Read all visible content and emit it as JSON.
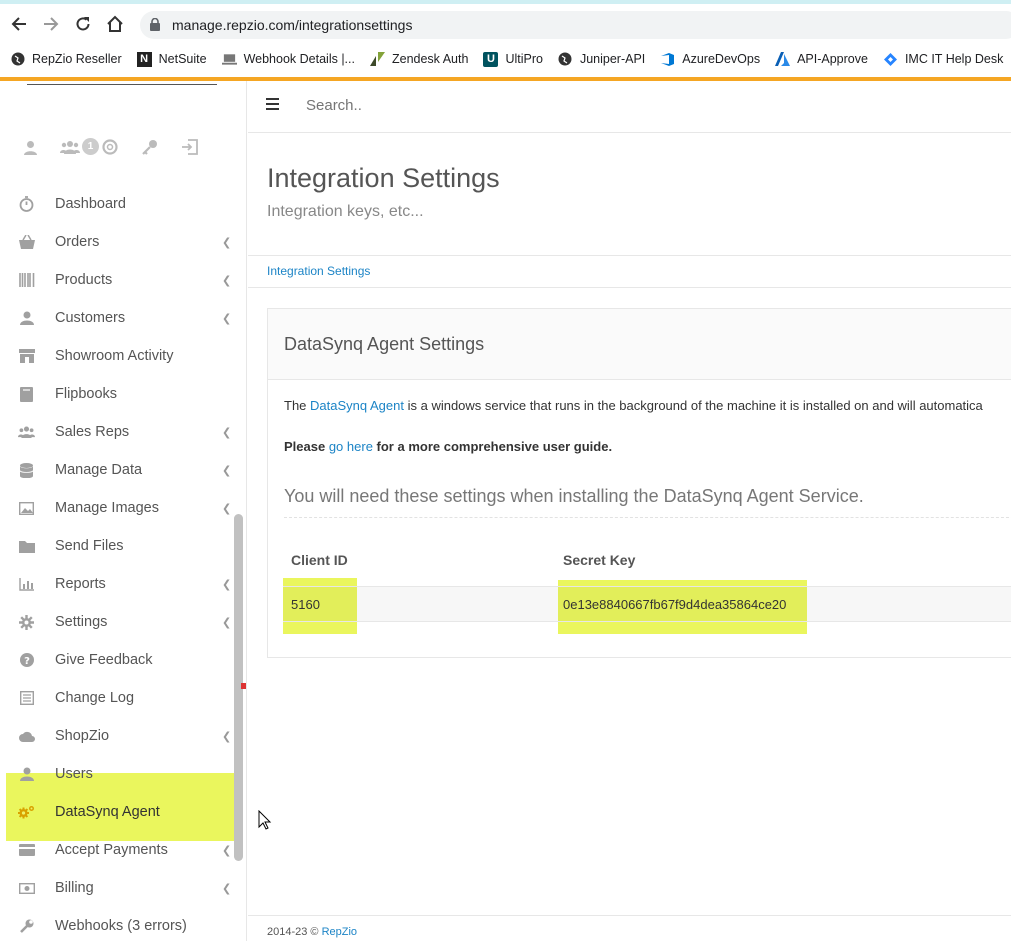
{
  "browser": {
    "url": "manage.repzio.com/integrationsettings",
    "bookmarks": [
      {
        "label": "RepZio Reseller",
        "icon": "globe-icon"
      },
      {
        "label": "NetSuite",
        "icon": "netsuite-icon"
      },
      {
        "label": "Webhook Details |...",
        "icon": "laptop-icon"
      },
      {
        "label": "Zendesk Auth",
        "icon": "zendesk-icon"
      },
      {
        "label": "UltiPro",
        "icon": "ultipro-icon"
      },
      {
        "label": "Juniper-API",
        "icon": "globe-icon"
      },
      {
        "label": "AzureDevOps",
        "icon": "azure-devops-icon"
      },
      {
        "label": "API-Approve",
        "icon": "azure-icon"
      },
      {
        "label": "IMC IT Help Desk",
        "icon": "jira-icon"
      }
    ]
  },
  "sidebar": {
    "user_badge": "1",
    "items": [
      {
        "label": "Dashboard",
        "icon": "stopwatch-icon",
        "chevron": false
      },
      {
        "label": "Orders",
        "icon": "basket-icon",
        "chevron": true
      },
      {
        "label": "Products",
        "icon": "barcode-icon",
        "chevron": true
      },
      {
        "label": "Customers",
        "icon": "user-icon",
        "chevron": true
      },
      {
        "label": "Showroom Activity",
        "icon": "store-icon",
        "chevron": false
      },
      {
        "label": "Flipbooks",
        "icon": "book-icon",
        "chevron": false
      },
      {
        "label": "Sales Reps",
        "icon": "users-icon",
        "chevron": true
      },
      {
        "label": "Manage Data",
        "icon": "database-icon",
        "chevron": true
      },
      {
        "label": "Manage Images",
        "icon": "image-icon",
        "chevron": true
      },
      {
        "label": "Send Files",
        "icon": "folder-icon",
        "chevron": false
      },
      {
        "label": "Reports",
        "icon": "bar-chart-icon",
        "chevron": true
      },
      {
        "label": "Settings",
        "icon": "gear-icon",
        "chevron": true
      },
      {
        "label": "Give Feedback",
        "icon": "question-icon",
        "chevron": false
      },
      {
        "label": "Change Log",
        "icon": "list-icon",
        "chevron": false
      },
      {
        "label": "ShopZio",
        "icon": "cloud-icon",
        "chevron": true
      },
      {
        "label": "Users",
        "icon": "user-icon",
        "chevron": false
      },
      {
        "label": "DataSynq Agent",
        "icon": "gears-icon",
        "chevron": false,
        "active": true
      },
      {
        "label": "Accept Payments",
        "icon": "credit-card-icon",
        "chevron": true
      },
      {
        "label": "Billing",
        "icon": "money-icon",
        "chevron": true
      },
      {
        "label": "Webhooks (3 errors)",
        "icon": "wrench-icon",
        "chevron": false
      }
    ]
  },
  "topbar": {
    "search_placeholder": "Search.."
  },
  "page": {
    "title": "Integration Settings",
    "subtitle": "Integration keys, etc...",
    "breadcrumb": "Integration Settings"
  },
  "panel": {
    "title": "DataSynq Agent Settings",
    "p1_before": "The ",
    "p1_link": "DataSynq Agent",
    "p1_after": " is a windows service that runs in the background of the machine it is installed on and will automatica",
    "p2_before": "Please ",
    "p2_link": "go here",
    "p2_after": " for a more comprehensive user guide.",
    "p3": "You will need these settings when installing the DataSynq Agent Service.",
    "table": {
      "headers": [
        "Client ID",
        "Secret Key"
      ],
      "row": [
        "5160",
        "0e13e8840667fb67f9d4dea35864ce20"
      ]
    }
  },
  "footer": {
    "prefix": "2014-23 © ",
    "link": "RepZio"
  },
  "colors": {
    "accent": "#1c84c6",
    "highlight": "#e6f541",
    "orange": "#f5a623"
  }
}
